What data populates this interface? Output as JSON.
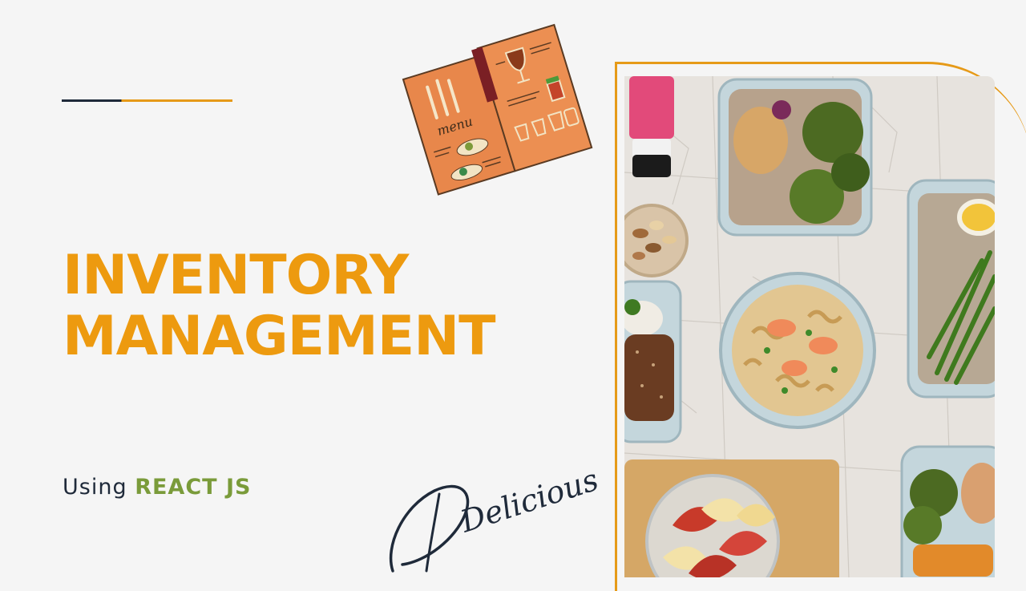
{
  "slide": {
    "title_line1": "INVENTORY",
    "title_line2": "MANAGEMENT",
    "subtitle_prefix": "Using",
    "subtitle_tech": "REACT JS",
    "script_word": "Delicious",
    "menu_label": "menu"
  },
  "colors": {
    "background": "#f5f5f5",
    "accent_orange": "#ed9a0f",
    "dark_navy": "#1f2a3a",
    "olive_green": "#7a9b3a"
  },
  "illustrations": {
    "menu_book": "menu-book-illustration",
    "food_photo": "meal-prep-containers-photo"
  }
}
